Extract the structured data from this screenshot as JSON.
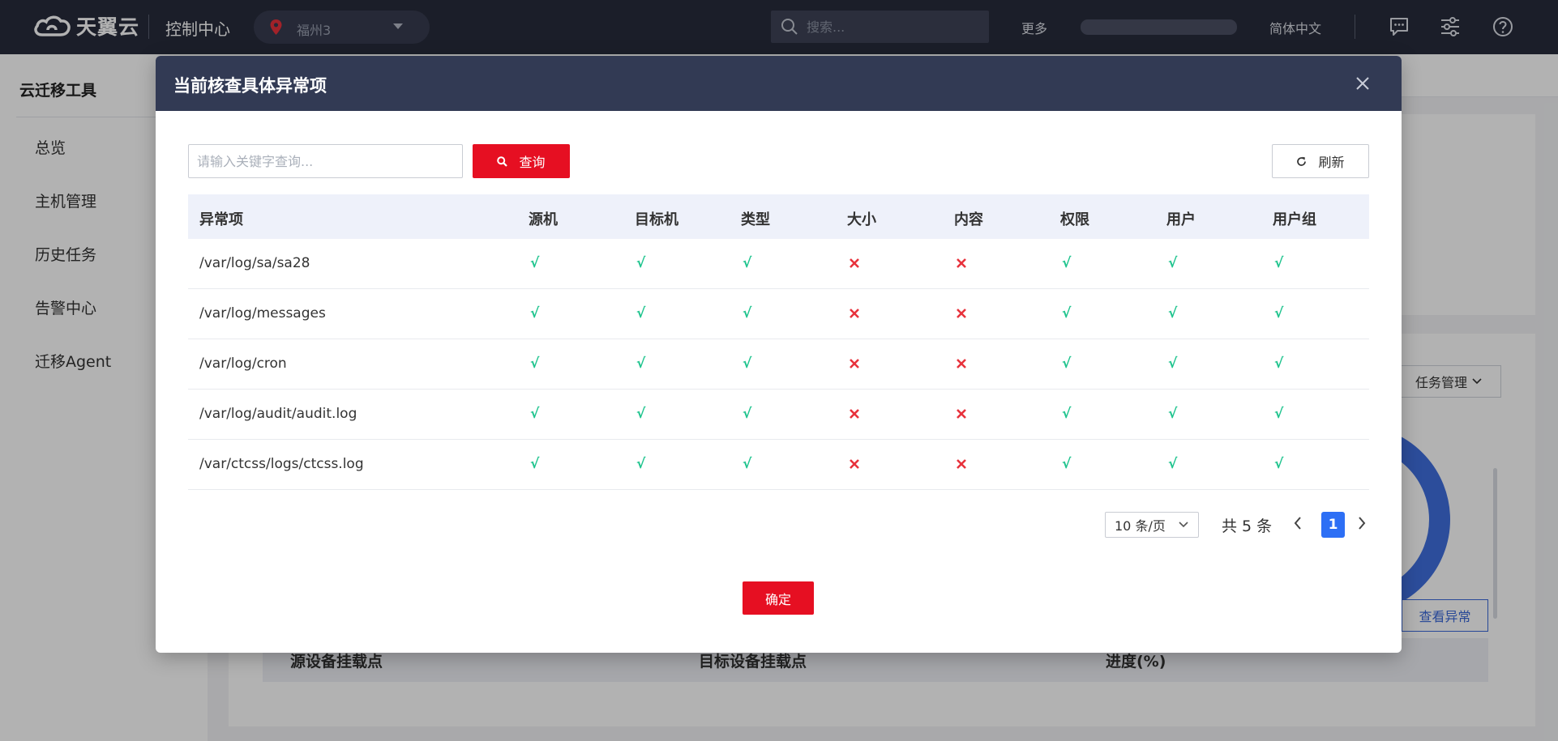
{
  "topbar": {
    "brand": "天翼云",
    "console_title": "控制中心",
    "region": "福州3",
    "search_placeholder": "搜索...",
    "more": "更多",
    "language": "简体中文"
  },
  "sidebar": {
    "title": "云迁移工具",
    "items": [
      {
        "label": "总览"
      },
      {
        "label": "主机管理"
      },
      {
        "label": "历史任务"
      },
      {
        "label": "告警中心"
      },
      {
        "label": "迁移Agent"
      }
    ]
  },
  "background": {
    "task_manage_label": "任务管理",
    "view_exception_label": "查看异常",
    "table_headers": [
      "源设备挂载点",
      "目标设备挂载点",
      "进度(%)"
    ]
  },
  "modal": {
    "title": "当前核查具体异常项",
    "keyword_placeholder": "请输入关键字查询...",
    "query_label": "查询",
    "refresh_label": "刷新",
    "columns": [
      "异常项",
      "源机",
      "目标机",
      "类型",
      "大小",
      "内容",
      "权限",
      "用户",
      "用户组"
    ],
    "rows": [
      {
        "path": "/var/log/sa/sa28",
        "checks": [
          true,
          true,
          true,
          false,
          false,
          true,
          true,
          true
        ]
      },
      {
        "path": "/var/log/messages",
        "checks": [
          true,
          true,
          true,
          false,
          false,
          true,
          true,
          true
        ]
      },
      {
        "path": "/var/log/cron",
        "checks": [
          true,
          true,
          true,
          false,
          false,
          true,
          true,
          true
        ]
      },
      {
        "path": "/var/log/audit/audit.log",
        "checks": [
          true,
          true,
          true,
          false,
          false,
          true,
          true,
          true
        ]
      },
      {
        "path": "/var/ctcss/logs/ctcss.log",
        "checks": [
          true,
          true,
          true,
          false,
          false,
          true,
          true,
          true
        ]
      }
    ],
    "check_mark": "√",
    "pagination": {
      "page_size": "10 条/页",
      "total": "共 5 条",
      "current_page": "1"
    },
    "confirm_label": "确定"
  },
  "colors": {
    "topbar_bg": "#282c3c",
    "modal_header_bg": "#323a54",
    "primary_red": "#e60f22",
    "ok_green": "#1fc48e",
    "fail_red": "#e8323c",
    "page_blue": "#2d6ff5"
  }
}
